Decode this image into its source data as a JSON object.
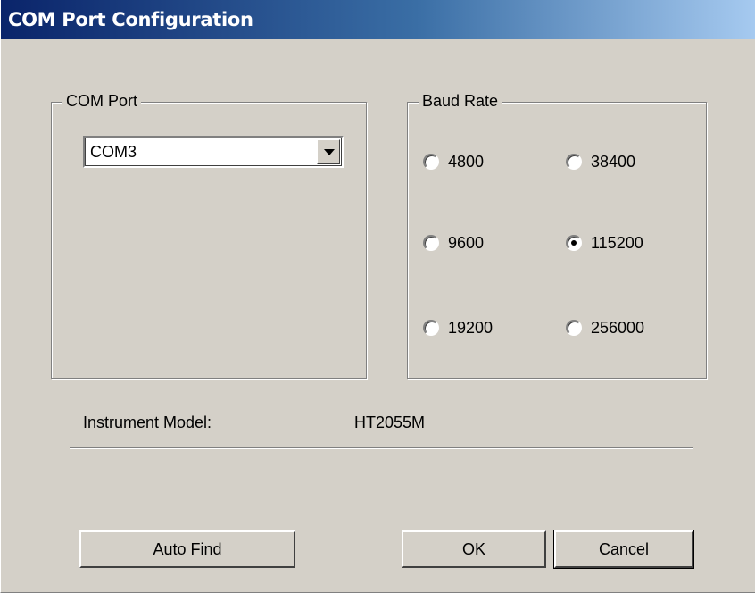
{
  "window": {
    "title": "COM Port  Configuration"
  },
  "com_port": {
    "group_label": "COM Port",
    "selected_value": "COM3"
  },
  "baud_rate": {
    "group_label": "Baud Rate",
    "options": [
      "4800",
      "38400",
      "9600",
      "115200",
      "19200",
      "256000"
    ],
    "selected": "115200"
  },
  "instrument": {
    "label": "Instrument Model:",
    "value": "HT2055M"
  },
  "buttons": {
    "auto_find": "Auto Find",
    "ok": "OK",
    "cancel": "Cancel"
  },
  "colors": {
    "dialog_bg": "#d4d0c8",
    "title_start": "#0a246a",
    "title_end": "#a6caf0"
  }
}
